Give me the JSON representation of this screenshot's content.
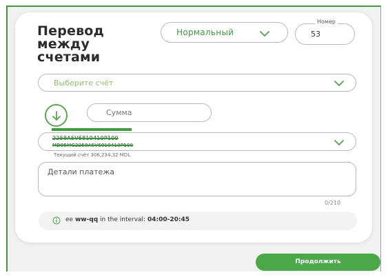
{
  "form": {
    "title": [
      "Перевод",
      "между",
      "счетами"
    ],
    "transfer_type": {
      "selected": "Нормальный",
      "icon": "chevron-down-icon"
    },
    "number": {
      "caption": "Номер",
      "value": "53"
    },
    "account_from": {
      "placeholder": "Выберите счёт",
      "icon": "chevron-down-icon"
    },
    "direction_icon": "arrow-down-circle-icon",
    "amount": {
      "placeholder": "Сумма"
    },
    "account_to": {
      "line1": "2258A5V6819410P100",
      "line2": "MD95MG2258A5V6819410P100",
      "balance": "Текущий счёт 306,234.32 MDL",
      "icon": "chevron-down-icon"
    },
    "details": {
      "placeholder": "Детали платежа",
      "counter": "0/210"
    },
    "info": {
      "icon": "info-circle-icon",
      "text_prefix": "ee ",
      "text_highlight": "ww-qq",
      "text_suffix": " in the interval: ",
      "time": "04:00-20:45"
    },
    "continue_label": "Продолжить"
  },
  "colors": {
    "accent": "#4aa848",
    "frame_border": "#3e9a36",
    "placeholder_green": "#8fc06e",
    "background": "#f1f1f1"
  }
}
